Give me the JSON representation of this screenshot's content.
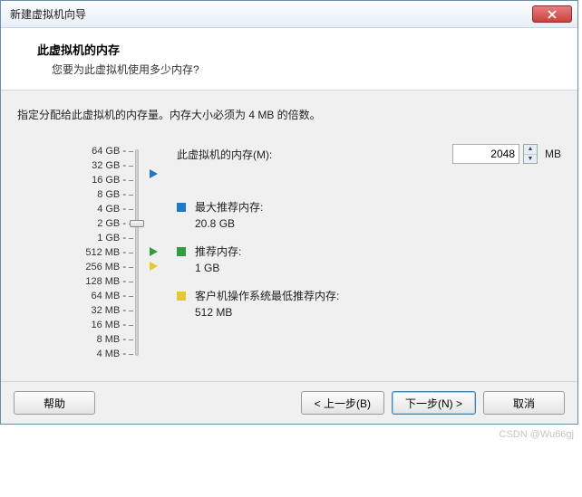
{
  "window": {
    "title": "新建虚拟机向导"
  },
  "header": {
    "title": "此虚拟机的内存",
    "subtitle": "您要为此虚拟机使用多少内存?"
  },
  "instruction": "指定分配给此虚拟机的内存量。内存大小必须为 4 MB 的倍数。",
  "scale": [
    "64 GB",
    "32 GB",
    "16 GB",
    "8 GB",
    "4 GB",
    "2 GB",
    "1 GB",
    "512 MB",
    "256 MB",
    "128 MB",
    "64 MB",
    "32 MB",
    "16 MB",
    "8 MB",
    "4 MB"
  ],
  "memory": {
    "label": "此虚拟机的内存(M):",
    "value": "2048",
    "unit": "MB"
  },
  "recommendations": {
    "max": {
      "label": "最大推荐内存:",
      "value": "20.8 GB"
    },
    "rec": {
      "label": "推荐内存:",
      "value": "1 GB"
    },
    "min": {
      "label": "客户机操作系统最低推荐内存:",
      "value": "512 MB"
    }
  },
  "buttons": {
    "help": "帮助",
    "back": "< 上一步(B)",
    "next": "下一步(N) >",
    "cancel": "取消"
  },
  "watermark": "CSDN @Wu66gj"
}
